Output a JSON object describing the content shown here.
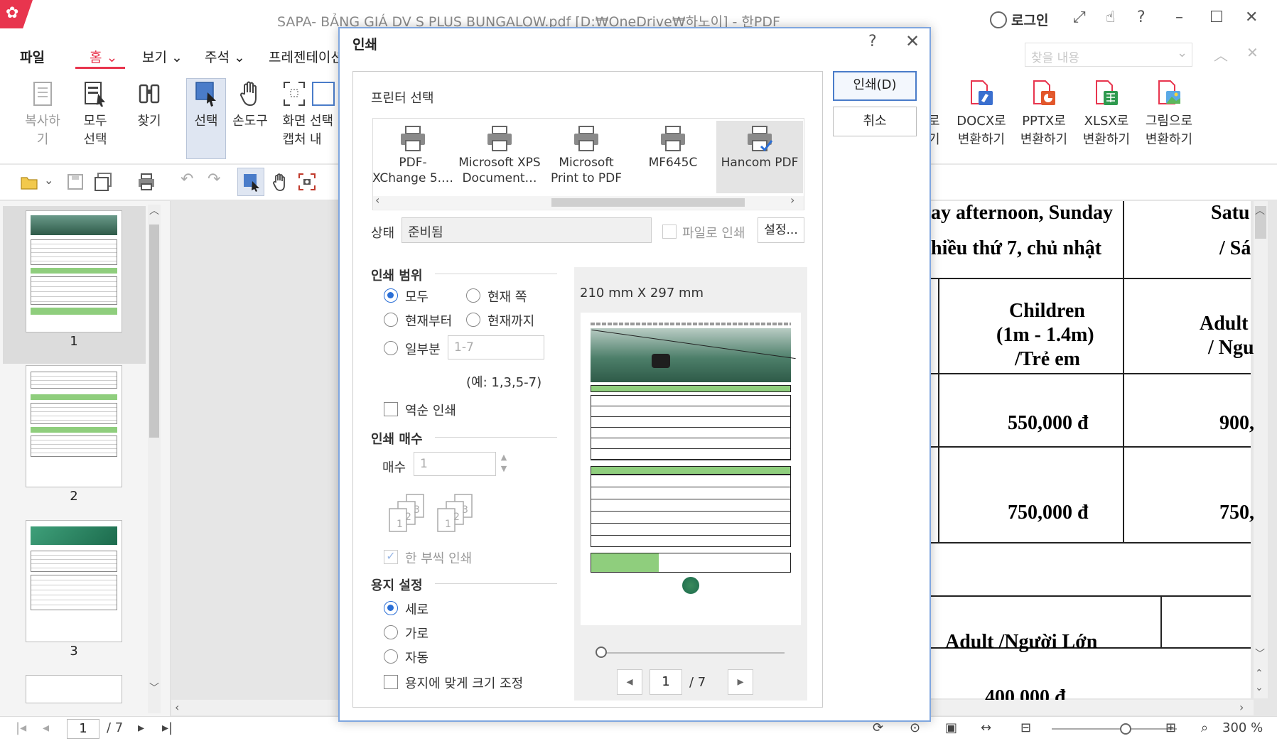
{
  "window": {
    "title": "SAPA- BẢNG GIÁ DV S PLUS BUNGALOW.pdf [D:₩OneDrive₩하노이] - 한PDF",
    "login": "로그인"
  },
  "menu": {
    "file": "파일",
    "tabs": [
      "홈",
      "보기",
      "주석",
      "프레젠테이션"
    ],
    "search_placeholder": "찾을 내용"
  },
  "ribbon": {
    "copy": "복사하기",
    "select_all_1": "모두",
    "select_all_2": "선택",
    "find": "찾기",
    "select": "선택",
    "hand_tool": "손도구",
    "capture_1": "화면",
    "capture_2": "캡처",
    "partial_1": "선택",
    "partial_2": "내",
    "partial_right_1": "로",
    "partial_right_2": "기",
    "docx_1": "DOCX로",
    "docx_2": "변환하기",
    "pptx_1": "PPTX로",
    "pptx_2": "변환하기",
    "xlsx_1": "XLSX로",
    "xlsx_2": "변환하기",
    "image_1": "그림으로",
    "image_2": "변환하기"
  },
  "thumbnails": [
    "1",
    "2",
    "3"
  ],
  "document": {
    "header_1": "ay afternoon, Sunday",
    "header_2": "hiều thứ 7, chủ nhật",
    "header_3": "Satu",
    "header_4": "/ Sá",
    "children_1": "Children",
    "children_2": "(1m - 1.4m)",
    "children_3": "/Trẻ em",
    "adult_1": "Adult",
    "adult_2": "/ Ngu",
    "price_1": "550,000 đ",
    "price_1b": "900,",
    "price_2": "750,000 đ",
    "price_2b": "750,",
    "adult_full": "Adult /Người Lớn",
    "price_3": "400,000 đ"
  },
  "dialog": {
    "title": "인쇄",
    "help": "?",
    "print_button": "인쇄(D)",
    "cancel_button": "취소",
    "printer_section": "프린터 선택",
    "printers": [
      {
        "l1": "PDF-",
        "l2": "XChange 5.…"
      },
      {
        "l1": "Microsoft XPS",
        "l2": "Document…"
      },
      {
        "l1": "Microsoft",
        "l2": "Print to PDF"
      },
      {
        "l1": "MF645C",
        "l2": ""
      },
      {
        "l1": "Hancom PDF",
        "l2": ""
      }
    ],
    "status_label": "상태",
    "status_value": "준비됨",
    "print_to_file": "파일로 인쇄",
    "settings": "설정...",
    "range_section": "인쇄 범위",
    "range_all": "모두",
    "range_current": "현재 쪽",
    "range_from": "현재부터",
    "range_to": "현재까지",
    "range_partial": "일부분",
    "range_partial_value": "1-7",
    "range_example": "(예: 1,3,5-7)",
    "reverse": "역순 인쇄",
    "copies_section": "인쇄 매수",
    "copies_label": "매수",
    "copies_value": "1",
    "collate": "한 부씩 인쇄",
    "paper_section": "용지 설정",
    "portrait": "세로",
    "landscape": "가로",
    "auto": "자동",
    "fit_paper": "용지에 맞게 크기 조정",
    "paper_size": "210  mm   X   297  mm",
    "preview_page": "1",
    "preview_total": "/  7"
  },
  "statusbar": {
    "page": "1",
    "total": "/ 7",
    "zoom": "300 %"
  },
  "colors": {
    "brand": "#e8354e",
    "accent": "#2b6fd6",
    "dialog_border": "#7fa6df"
  }
}
